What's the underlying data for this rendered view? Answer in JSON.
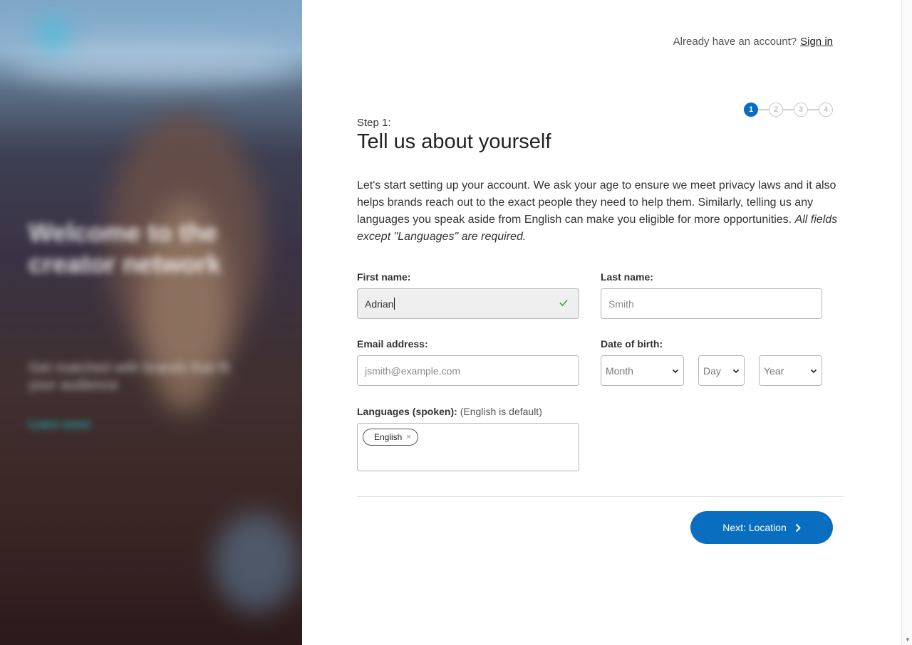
{
  "hero": {
    "headline": "Welcome to the creator network",
    "body": "Get matched with brands that fit your audience",
    "link": "Learn more"
  },
  "header": {
    "account_prompt": "Already have an account?",
    "sign_in": "Sign in"
  },
  "stepper": {
    "steps": [
      "1",
      "2",
      "3",
      "4"
    ],
    "current": 1
  },
  "form": {
    "step_label": "Step 1:",
    "title": "Tell us about yourself",
    "intro": "Let's start setting up your account. We ask your age to ensure we meet privacy laws and it also helps brands reach out to the exact people they need to help them. Similarly, telling us any languages you speak aside from English can make you eligible for more opportunities. ",
    "intro_emphasis": "All fields except \"Languages\" are required.",
    "first_name": {
      "label": "First name:",
      "value": "Adrian"
    },
    "last_name": {
      "label": "Last name:",
      "placeholder": "Smith"
    },
    "email": {
      "label": "Email address:",
      "placeholder": "jsmith@example.com"
    },
    "dob": {
      "label": "Date of birth:",
      "month": "Month",
      "day": "Day",
      "year": "Year"
    },
    "languages": {
      "label": "Languages (spoken):",
      "sublabel": "(English is default)",
      "chips": [
        "English"
      ],
      "remove_glyph": "×"
    },
    "next_button": "Next: Location"
  },
  "colors": {
    "primary": "#0a6ec0",
    "valid": "#2fa84f"
  }
}
